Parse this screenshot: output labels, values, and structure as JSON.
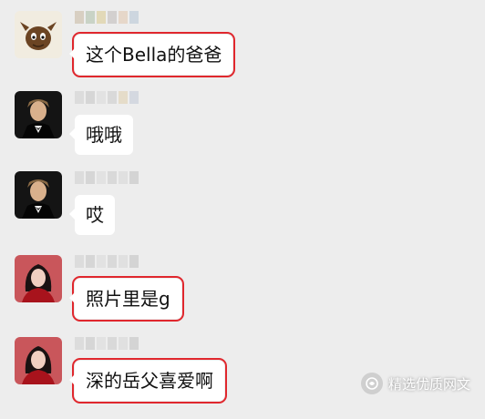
{
  "messages": [
    {
      "text": "这个Bella的爸爸",
      "avatar": "cartoon-creature-avatar",
      "highlighted": true
    },
    {
      "text": "哦哦",
      "avatar": "man-tuxedo-avatar",
      "highlighted": false
    },
    {
      "text": "哎",
      "avatar": "man-tuxedo-avatar",
      "highlighted": false
    },
    {
      "text": "照片里是g",
      "avatar": "woman-red-dress-avatar",
      "highlighted": true
    },
    {
      "text": "深的岳父喜爱啊",
      "avatar": "woman-red-dress-avatar",
      "highlighted": true
    }
  ],
  "watermark": {
    "text": "精选优质网文",
    "icon": "wechat-official-account-logo-icon"
  },
  "colors": {
    "background": "#ededed",
    "bubble": "#ffffff",
    "highlight_box": "#e0272d"
  }
}
